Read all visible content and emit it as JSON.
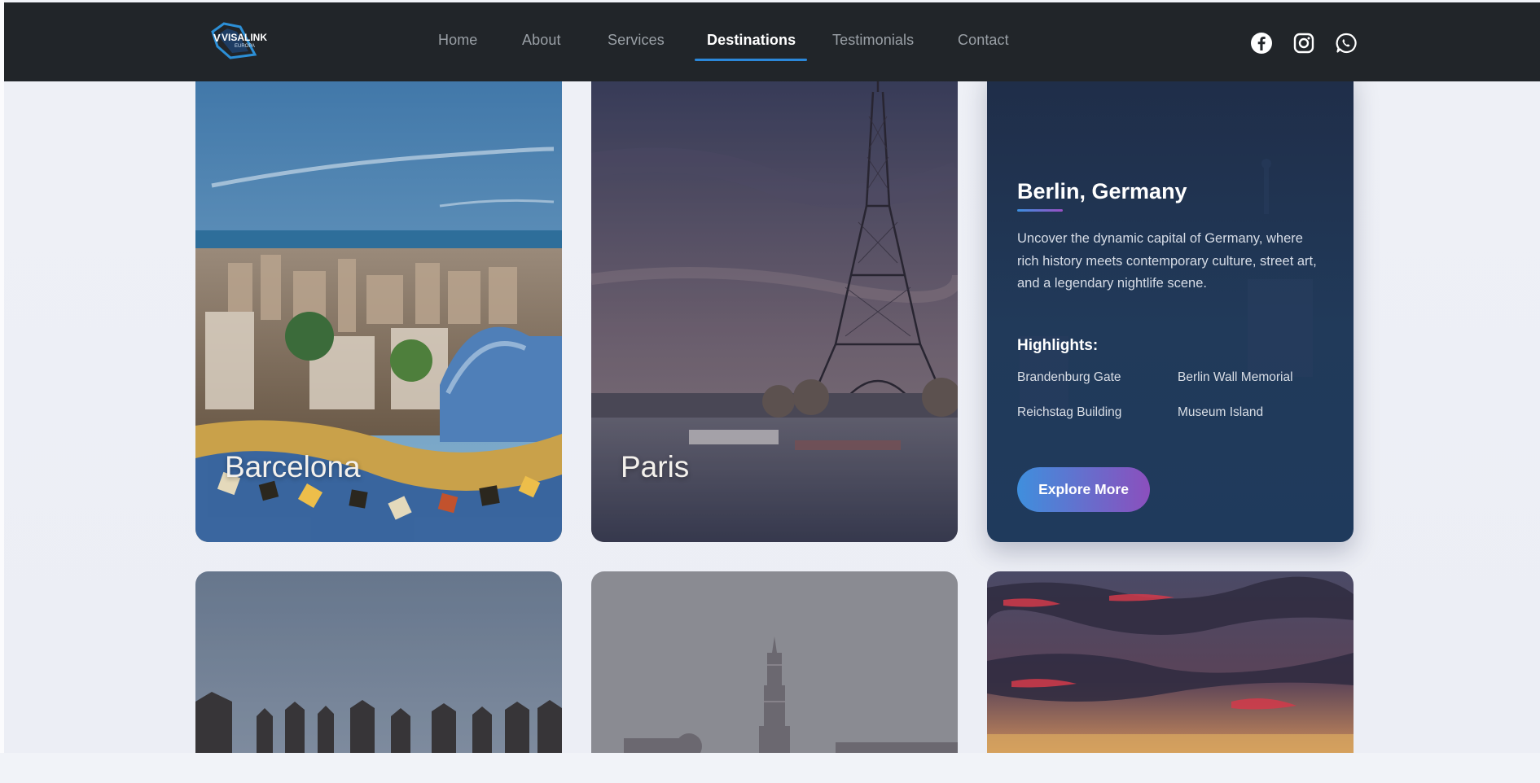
{
  "nav": {
    "logo_text": "VISALINK",
    "logo_sub": "EUROPA",
    "links": [
      "Home",
      "About",
      "Services",
      "Destinations",
      "Testimonials",
      "Contact"
    ],
    "active": "Destinations",
    "social_icons": [
      "facebook-icon",
      "instagram-icon",
      "whatsapp-icon"
    ]
  },
  "cards": {
    "barcelona": {
      "label": "Barcelona"
    },
    "paris": {
      "label": "Paris"
    },
    "berlin": {
      "title": "Berlin, Germany",
      "description": "Uncover the dynamic capital of Germany, where rich history meets contemporary culture, street art, and a legendary nightlife scene.",
      "highlights_title": "Highlights:",
      "highlights": [
        "Brandenburg Gate",
        "Berlin Wall Memorial",
        "Reichstag Building",
        "Museum Island"
      ],
      "button_label": "Explore More"
    }
  },
  "colors": {
    "nav_bg": "#212529",
    "accent_blue": "#2b87d9",
    "accent_purple": "#8b4fbd",
    "berlin_card_bg": "#1f3353"
  }
}
